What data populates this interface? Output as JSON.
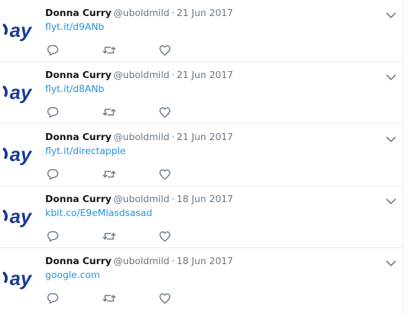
{
  "tweets": [
    {
      "name": "Donna Curry",
      "handle": "@uboldmild",
      "separator": "·",
      "date": "21 Jun 2017",
      "link": "flyt.it/d9ANb"
    },
    {
      "name": "Donna Curry",
      "handle": "@uboldmild",
      "separator": "·",
      "date": "21 Jun 2017",
      "link": "flyt.it/d8ANb"
    },
    {
      "name": "Donna Curry",
      "handle": "@uboldmild",
      "separator": "·",
      "date": "21 Jun 2017",
      "link": "flyt.it/directapple"
    },
    {
      "name": "Donna Curry",
      "handle": "@uboldmild",
      "separator": "·",
      "date": "18 Jun 2017",
      "link": "kbit.co/E9eMlasdsasad"
    },
    {
      "name": "Donna Curry",
      "handle": "@uboldmild",
      "separator": "·",
      "date": "18 Jun 2017",
      "link": "google.com"
    }
  ],
  "avatar": {
    "text": "ay",
    "color": "#1a3a8f"
  },
  "icons": {
    "more": "chevron-down-icon",
    "reply": "reply-icon",
    "retweet": "retweet-icon",
    "like": "heart-icon"
  },
  "colors": {
    "link": "#1b95e0",
    "secondary_text": "#657786",
    "icon": "#657786",
    "divider": "#e6ecf0"
  }
}
